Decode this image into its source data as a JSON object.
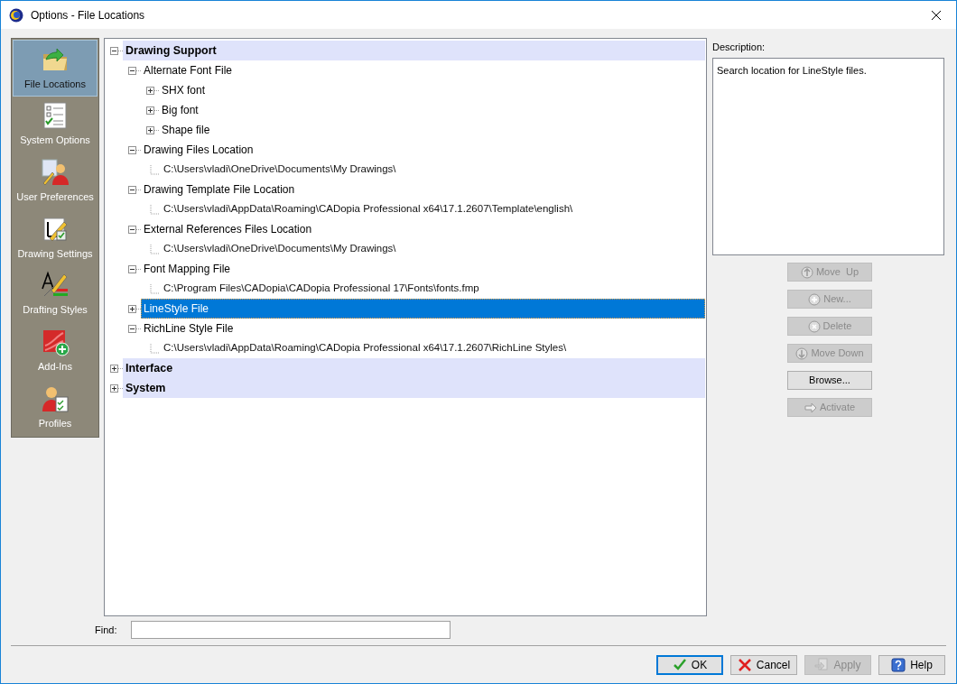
{
  "window": {
    "title": "Options - File Locations"
  },
  "sidebar": {
    "items": [
      {
        "label": "File Locations",
        "selected": true
      },
      {
        "label": "System Options",
        "selected": false
      },
      {
        "label": "User Preferences",
        "selected": false
      },
      {
        "label": "Drawing Settings",
        "selected": false
      },
      {
        "label": "Drafting Styles",
        "selected": false
      },
      {
        "label": "Add-Ins",
        "selected": false
      },
      {
        "label": "Profiles",
        "selected": false
      }
    ]
  },
  "tree": [
    {
      "kind": "category",
      "label": "Drawing Support",
      "expanded": true,
      "selected": false,
      "children": [
        {
          "kind": "setting",
          "label": "Alternate Font File",
          "expanded": true,
          "selected": false,
          "children": [
            {
              "kind": "setting",
              "label": "SHX font",
              "expanded": false,
              "selected": false
            },
            {
              "kind": "setting",
              "label": "Big font",
              "expanded": false,
              "selected": false
            },
            {
              "kind": "setting",
              "label": "Shape file",
              "expanded": false,
              "selected": false
            }
          ]
        },
        {
          "kind": "setting",
          "label": "Drawing Files Location",
          "expanded": true,
          "selected": false,
          "children": [
            {
              "kind": "path",
              "label": "C:\\Users\\vladi\\OneDrive\\Documents\\My Drawings\\",
              "selected": false
            }
          ]
        },
        {
          "kind": "setting",
          "label": "Drawing Template File Location",
          "expanded": true,
          "selected": false,
          "children": [
            {
              "kind": "path",
              "label": "C:\\Users\\vladi\\AppData\\Roaming\\CADopia Professional x64\\17.1.2607\\Template\\english\\",
              "selected": false
            }
          ]
        },
        {
          "kind": "setting",
          "label": "External References Files Location",
          "expanded": true,
          "selected": false,
          "children": [
            {
              "kind": "path",
              "label": "C:\\Users\\vladi\\OneDrive\\Documents\\My Drawings\\",
              "selected": false
            }
          ]
        },
        {
          "kind": "setting",
          "label": "Font Mapping File",
          "expanded": true,
          "selected": false,
          "children": [
            {
              "kind": "path",
              "label": "C:\\Program Files\\CADopia\\CADopia Professional 17\\Fonts\\fonts.fmp",
              "selected": false
            }
          ]
        },
        {
          "kind": "setting",
          "label": "LineStyle File",
          "expanded": false,
          "selected": true
        },
        {
          "kind": "setting",
          "label": "RichLine Style File",
          "expanded": true,
          "selected": false,
          "children": [
            {
              "kind": "path",
              "label": "C:\\Users\\vladi\\AppData\\Roaming\\CADopia Professional x64\\17.1.2607\\RichLine Styles\\",
              "selected": false
            }
          ]
        }
      ]
    },
    {
      "kind": "category",
      "label": "Interface",
      "expanded": false,
      "selected": false
    },
    {
      "kind": "category",
      "label": "System",
      "expanded": false,
      "selected": false
    }
  ],
  "description": {
    "label": "Description:",
    "text": "Search location for LineStyle files."
  },
  "side_buttons": [
    {
      "label": "Move  Up",
      "disabled": true
    },
    {
      "label": "New...",
      "disabled": true
    },
    {
      "label": "Delete",
      "disabled": true
    },
    {
      "label": "Move Down",
      "disabled": true
    },
    {
      "label": "Browse...",
      "disabled": false
    },
    {
      "label": "Activate",
      "disabled": true
    }
  ],
  "find": {
    "label": "Find:"
  },
  "dialog_buttons": [
    {
      "label": "OK",
      "disabled": false,
      "default": true
    },
    {
      "label": "Cancel",
      "disabled": false,
      "default": false
    },
    {
      "label": "Apply",
      "disabled": true,
      "default": false
    },
    {
      "label": "Help",
      "disabled": false,
      "default": false
    }
  ]
}
